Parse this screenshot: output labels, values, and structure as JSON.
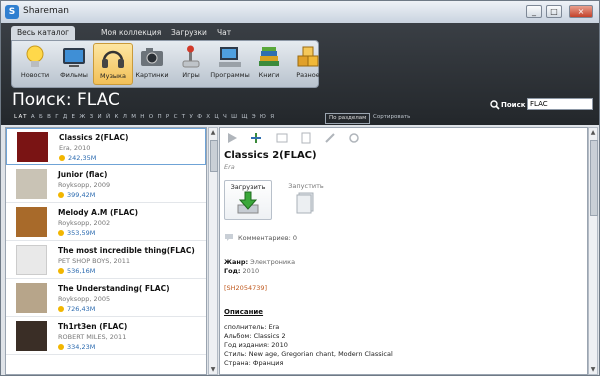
{
  "window": {
    "title": "Shareman",
    "app_icon": "S",
    "controls": [
      "_",
      "□",
      "×"
    ]
  },
  "tabs": [
    {
      "label": "Весь каталог",
      "active": true
    },
    {
      "label": "Моя коллекция",
      "active": false
    },
    {
      "label": "Загрузки",
      "active": false
    },
    {
      "label": "Чат",
      "active": false
    }
  ],
  "categories": [
    {
      "label": "Новости",
      "icon": "lightbulb-icon"
    },
    {
      "label": "Фильмы",
      "icon": "tv-icon"
    },
    {
      "label": "Музыка",
      "icon": "headphones-icon",
      "active": true
    },
    {
      "label": "Картинки",
      "icon": "camera-icon"
    },
    {
      "label": "Игры",
      "icon": "joystick-icon"
    },
    {
      "label": "Программы",
      "icon": "computer-icon"
    },
    {
      "label": "Книги",
      "icon": "books-icon"
    },
    {
      "label": "Разное",
      "icon": "boxes-icon"
    }
  ],
  "search": {
    "heading": "Поиск: FLAC",
    "label": "Поиск",
    "value": "FLAC"
  },
  "alphabet": {
    "selected": "LAT",
    "letters": "А Б В Г Д Е Ж З И Й К Л М Н О П Р С Т У Ф Х Ц Ч Ш Щ Э Ю Я"
  },
  "filters": {
    "by_section": "По разделам",
    "sort": "Сортировать"
  },
  "results": [
    {
      "title": "Classics 2(FLAC)",
      "artist": "Era, 2010",
      "size": "242,35M",
      "thumb": "#7a1414"
    },
    {
      "title": "Junior (flac)",
      "artist": "Royksopp, 2009",
      "size": "399,42M",
      "thumb": "#c9c3b5"
    },
    {
      "title": "Melody A.M (FLAC)",
      "artist": "Royksopp, 2002",
      "size": "353,59M",
      "thumb": "#a86a2a"
    },
    {
      "title": "The most incredible thing(FLAC)",
      "artist": "PET SHOP BOYS, 2011",
      "size": "536,16M",
      "thumb": "#e9e9e9"
    },
    {
      "title": "The Understanding( FLAC)",
      "artist": "Royksopp, 2005",
      "size": "726,43M",
      "thumb": "#b7a58a"
    },
    {
      "title": "Th1rt3en (FLAC)",
      "artist": "ROBERT MILES, 2011",
      "size": "334,23M",
      "thumb": "#3a2e26"
    }
  ],
  "detail": {
    "title": "Classics 2(FLAC)",
    "artist": "Era",
    "download_label": "Загрузить",
    "run_label": "Запустить",
    "comments": "Комментариев: 0",
    "genre_label": "Жанр:",
    "genre": "Электроника",
    "year_label": "Год:",
    "year": "2010",
    "code": "[SH2054739]",
    "description_heading": "Описание",
    "description": [
      "сполнитель: Era",
      "Альбом: Classics 2",
      "Год издания: 2010",
      "Стиль: New age, Gregorian chant, Modern Classical",
      "Страна: Франция"
    ]
  }
}
